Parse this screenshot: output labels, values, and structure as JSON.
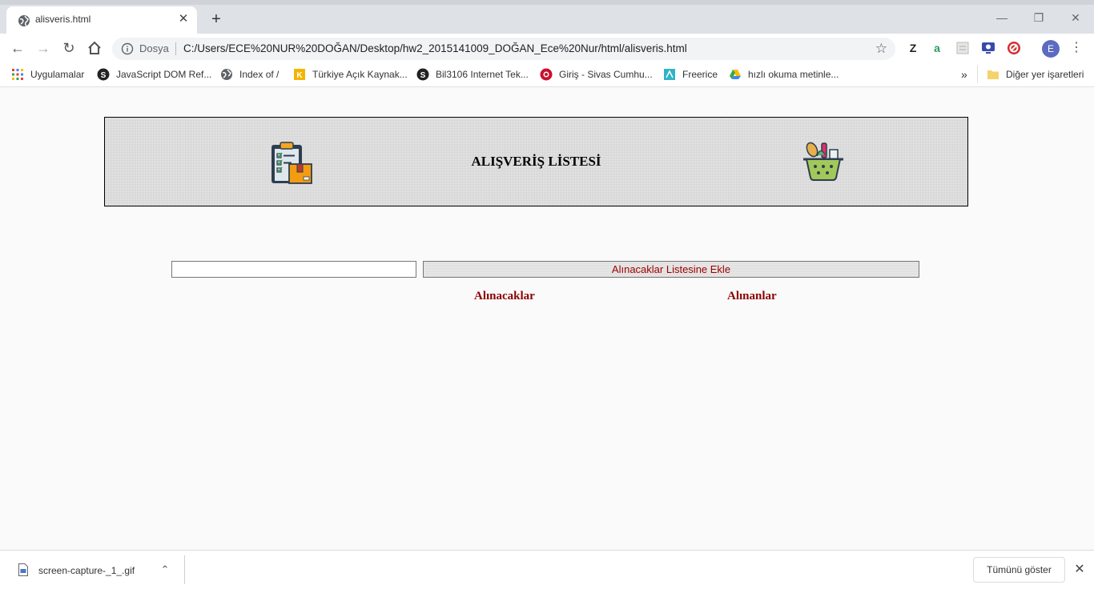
{
  "browser": {
    "tab_title": "alisveris.html",
    "tab_close": "✕",
    "new_tab": "+",
    "win_min": "—",
    "win_max": "❐",
    "win_close": "✕",
    "omnibox": {
      "secure_label": "Dosya",
      "url": "C:/Users/ECE%20NUR%20DOĞAN/Desktop/hw2_2015141009_DOĞAN_Ece%20Nur/html/alisveris.html"
    },
    "extensions": [
      "Z",
      "a"
    ],
    "profile_initial": "E",
    "bookmarks": [
      {
        "label": "Uygulamalar",
        "icon": "apps-grid-icon"
      },
      {
        "label": "JavaScript DOM Ref...",
        "icon": "s-circle-icon"
      },
      {
        "label": "Index of /",
        "icon": "globe-icon"
      },
      {
        "label": "Türkiye Açık Kaynak...",
        "icon": "k-square-icon"
      },
      {
        "label": "Bil3106 Internet Tek...",
        "icon": "s-circle-icon"
      },
      {
        "label": "Giriş - Sivas Cumhu...",
        "icon": "red-circle-icon"
      },
      {
        "label": "Freerice",
        "icon": "freerice-icon"
      },
      {
        "label": "hızlı okuma metinle...",
        "icon": "drive-icon"
      }
    ],
    "bookmarks_overflow": "»",
    "other_bookmarks": "Diğer yer işaretleri"
  },
  "page": {
    "title": "ALIŞVERİŞ LİSTESİ",
    "input_value": "",
    "add_button": "Alınacaklar Listesine Ekle",
    "col_to_buy": "Alınacaklar",
    "col_bought": "Alınanlar",
    "colors": {
      "heading": "#8b0000",
      "button_text": "#a00000"
    }
  },
  "downloads": {
    "file_name": "screen-capture-_1_.gif",
    "show_all": "Tümünü göster"
  }
}
